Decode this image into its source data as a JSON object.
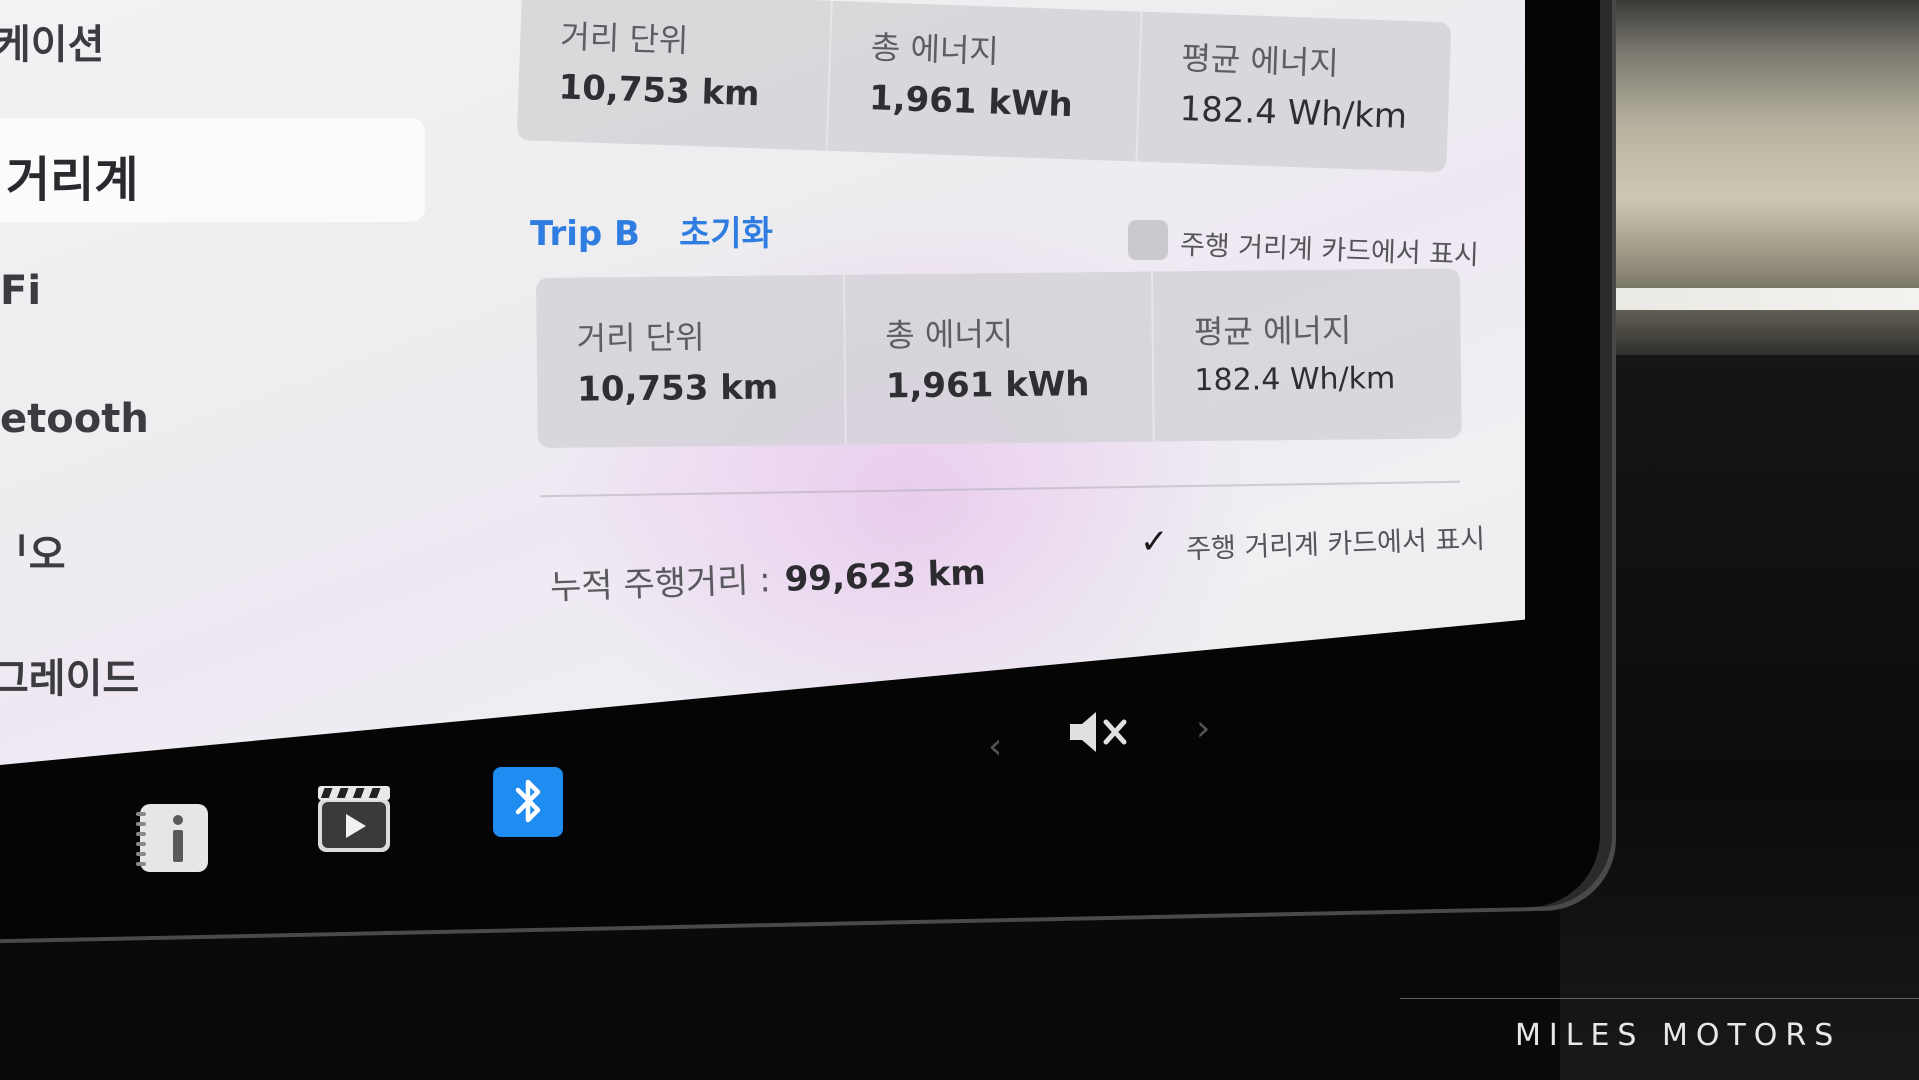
{
  "sidebar": {
    "items": [
      {
        "label": "내비게이션"
      },
      {
        "label": "주행거리계"
      },
      {
        "label": "Wi-Fi"
      },
      {
        "label": "Bluetooth"
      },
      {
        "label": "오디오"
      },
      {
        "label": "업그레이드"
      }
    ],
    "visible_items": [
      {
        "label": "케이션"
      },
      {
        "label": "거리계"
      },
      {
        "label": "Fi"
      },
      {
        "label": "etooth"
      },
      {
        "label": "ᅵ오"
      },
      {
        "label": "그레이드"
      }
    ]
  },
  "trip_a": {
    "distance_label": "거리 단위",
    "distance_value": "10,753  km",
    "energy_label": "총 에너지",
    "energy_value": "1,961 kWh",
    "avg_label": "평균 에너지",
    "avg_value": "182.4  Wh/km"
  },
  "trip_b": {
    "title": "Trip B",
    "reset_label": "초기화",
    "show_on_card_label": "주행 거리계 카드에서 표시",
    "show_on_card_checked": false,
    "distance_label": "거리 단위",
    "distance_value": "10,753  km",
    "energy_label": "총 에너지",
    "energy_value": "1,961 kWh",
    "avg_label": "평균 에너지",
    "avg_value": "182.4  Wh/km"
  },
  "odometer": {
    "label": "누적 주행거리 :",
    "value": "99,623 km",
    "show_on_card_label": "주행 거리계 카드에서 표시",
    "show_on_card_checked": true
  },
  "taskbar": {
    "icons": [
      "manual-icon",
      "media-player-icon",
      "bluetooth-icon"
    ],
    "volume_state": "muted"
  },
  "watermark": "MILES MOTORS",
  "colors": {
    "accent": "#2f7de0",
    "bluetooth_bg": "#1e8cf0"
  }
}
